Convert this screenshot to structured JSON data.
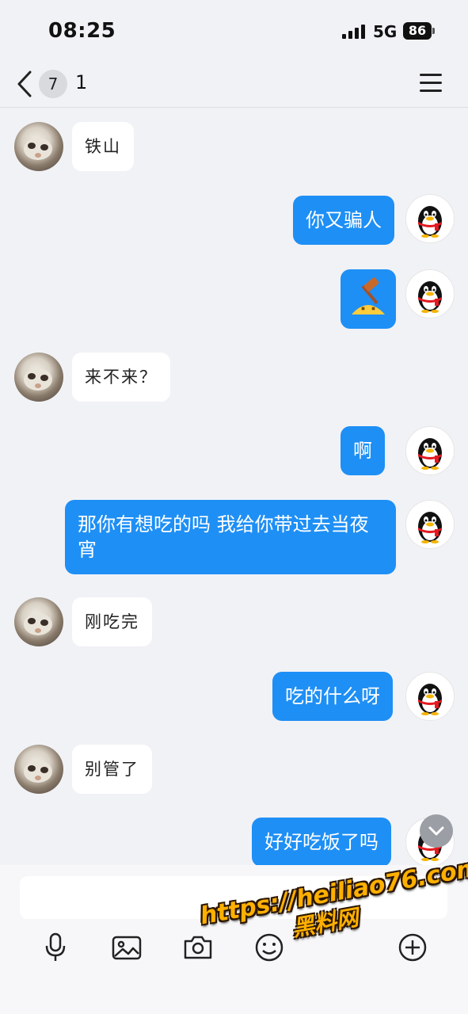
{
  "status_bar": {
    "time": "08:25",
    "network": "5G",
    "battery": "86"
  },
  "header": {
    "unread_count": "7",
    "title": "1"
  },
  "messages": [
    {
      "side": "in",
      "text": "铁山"
    },
    {
      "side": "out",
      "text": "你又骗人"
    },
    {
      "side": "out",
      "text": "",
      "sticker": "hammer-emoji"
    },
    {
      "side": "in",
      "text": "来不来？"
    },
    {
      "side": "out",
      "text": "啊"
    },
    {
      "side": "out",
      "text": "那你有想吃的吗 我给你带过去当夜宵"
    },
    {
      "side": "in",
      "text": "刚吃完"
    },
    {
      "side": "out",
      "text": "吃的什么呀"
    },
    {
      "side": "in",
      "text": "别管了"
    },
    {
      "side": "out",
      "text": "好好吃饭了吗"
    }
  ],
  "input": {
    "value": "",
    "placeholder": ""
  },
  "toolbar": {
    "icons": [
      "microphone-icon",
      "image-icon",
      "camera-icon",
      "emoji-icon",
      "plus-icon"
    ]
  },
  "watermark": {
    "url": "https://heiliao76.com",
    "label": "黑料网"
  },
  "colors": {
    "accent": "#1e8ff5",
    "background": "#f1f2f6",
    "incoming_bubble": "#ffffff"
  }
}
